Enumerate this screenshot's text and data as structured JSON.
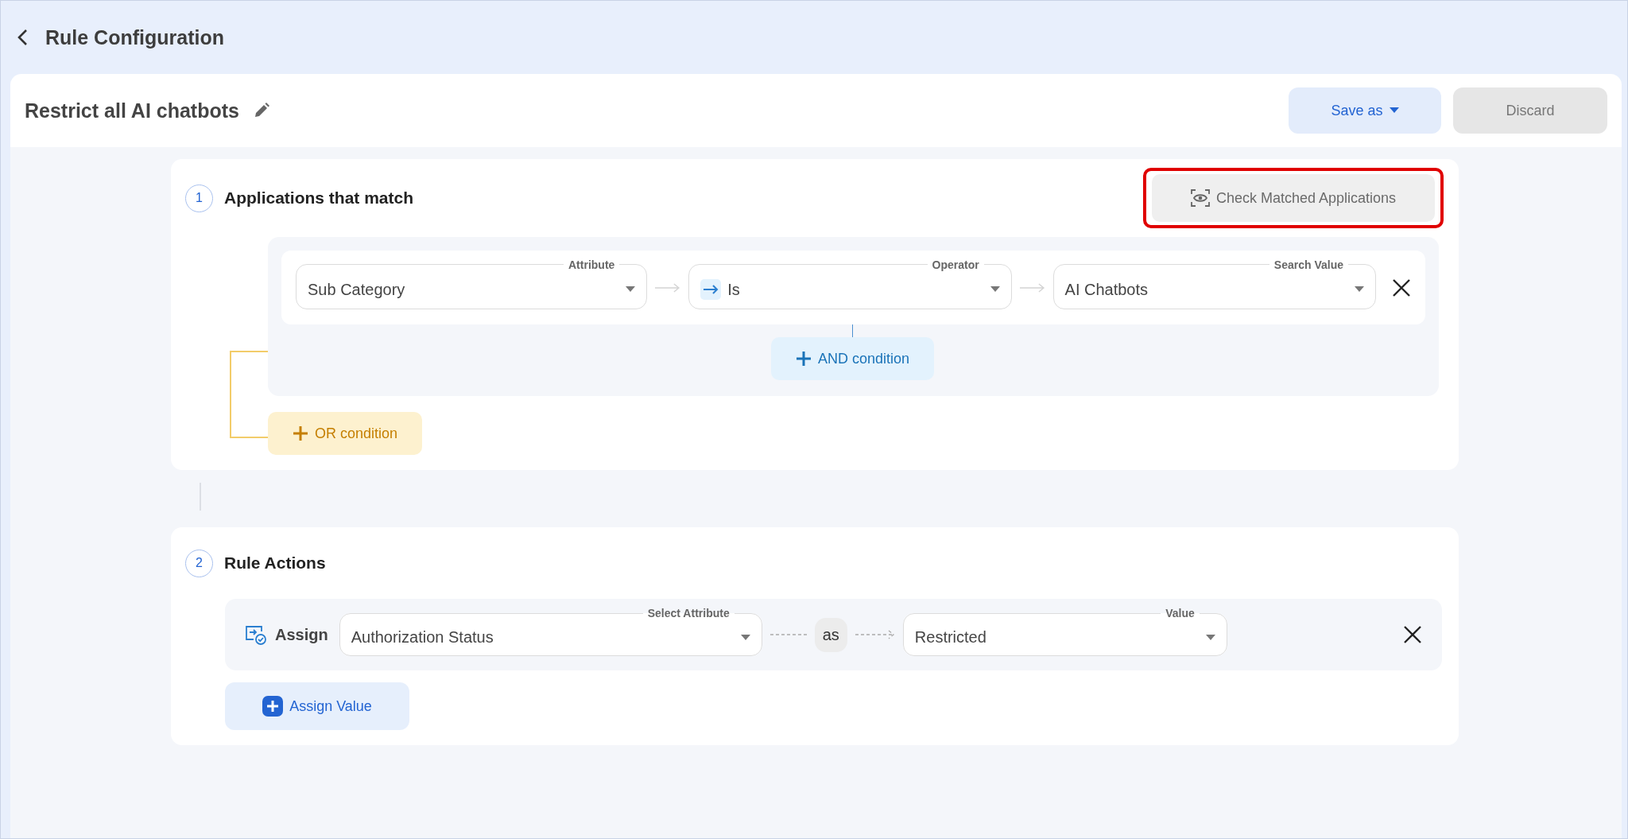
{
  "header": {
    "title": "Rule Configuration"
  },
  "rule": {
    "name": "Restrict all AI chatbots"
  },
  "buttons": [
    {
      "label": "Save as",
      "kind": "primary"
    },
    {
      "label": "Discard",
      "kind": "secondary"
    }
  ],
  "match_section": {
    "number": "1",
    "title": "Applications that match",
    "check_button": {
      "label": "Check Matched Applications",
      "highlighted": true
    },
    "condition_groups": [
      {
        "conditions": [
          {
            "attribute": {
              "label": "Attribute",
              "value": "Sub Category"
            },
            "operator": {
              "label": "Operator",
              "value": "Is"
            },
            "search_value": {
              "label": "Search Value",
              "value": "AI Chatbots"
            }
          }
        ],
        "and_button": "AND condition"
      }
    ],
    "or_button": "OR condition"
  },
  "actions_section": {
    "number": "2",
    "title": "Rule Actions",
    "actions": [
      {
        "verb": "Assign",
        "attribute": {
          "label": "Select Attribute",
          "value": "Authorization Status"
        },
        "connector": "as",
        "value": {
          "label": "Value",
          "value": "Restricted"
        }
      }
    ],
    "add_button": "Assign Value"
  }
}
